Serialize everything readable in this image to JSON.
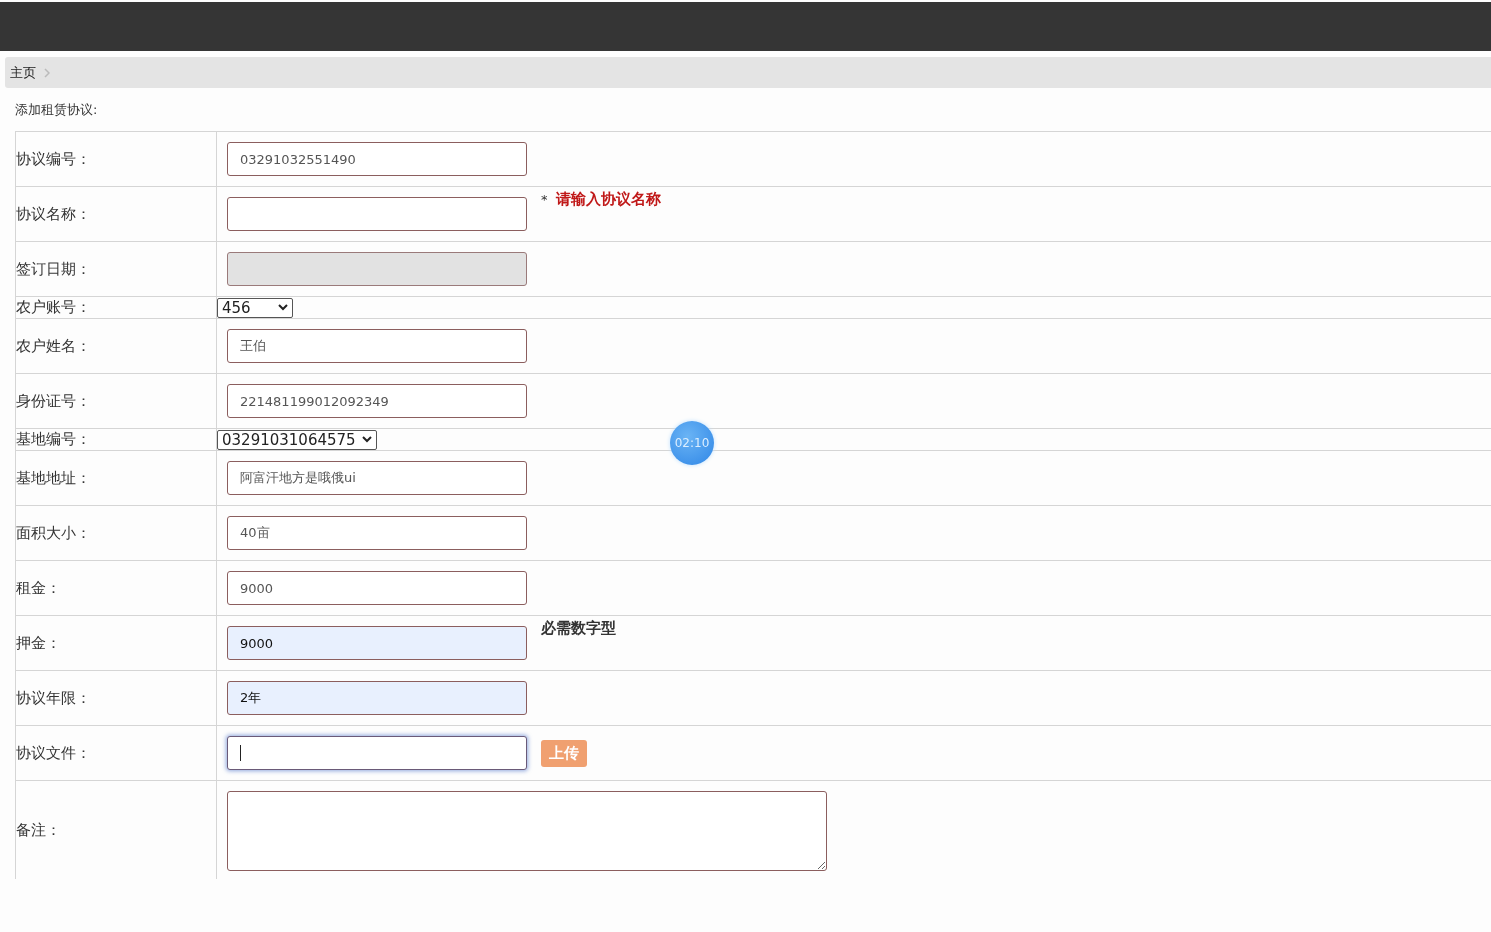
{
  "breadcrumb": {
    "items": [
      "主页"
    ]
  },
  "form_title": "添加租赁协议:",
  "fields": [
    {
      "label": "协议编号：",
      "kind": "text",
      "value": "03291032551490",
      "disabled": false,
      "autofilled": false,
      "focused": false
    },
    {
      "label": "协议名称：",
      "kind": "text",
      "disabled": false,
      "autofilled": false,
      "focused": false,
      "marker": "*",
      "hint": "请输入协议名称",
      "hint_error": true
    },
    {
      "label": "签订日期：",
      "kind": "text",
      "disabled": true,
      "autofilled": false,
      "focused": false
    },
    {
      "label": "农户账号：",
      "kind": "select",
      "value": "456"
    },
    {
      "label": "农户姓名：",
      "kind": "text",
      "value": "王伯",
      "disabled": false,
      "autofilled": false,
      "focused": false
    },
    {
      "label": "身份证号：",
      "kind": "text",
      "value": "221481199012092349",
      "disabled": false,
      "autofilled": false,
      "focused": false
    },
    {
      "label": "基地编号：",
      "kind": "select",
      "value": "03291031064575"
    },
    {
      "label": "基地地址：",
      "kind": "text",
      "value": "阿富汗地方是哦俄ui",
      "disabled": false,
      "autofilled": false,
      "focused": false
    },
    {
      "label": "面积大小：",
      "kind": "text",
      "value": "40亩",
      "disabled": false,
      "autofilled": false,
      "focused": false
    },
    {
      "label": "租金：",
      "kind": "text",
      "value": "9000",
      "disabled": false,
      "autofilled": false,
      "focused": false
    },
    {
      "label": "押金：",
      "kind": "text",
      "value": "9000",
      "disabled": false,
      "autofilled": true,
      "focused": false,
      "hint": "必需数字型",
      "hint_error": false
    },
    {
      "label": "协议年限：",
      "kind": "text",
      "value": "2年",
      "disabled": false,
      "autofilled": true,
      "focused": false
    },
    {
      "label": "协议文件：",
      "kind": "text",
      "disabled": false,
      "autofilled": false,
      "focused": true,
      "button": "上传"
    },
    {
      "label": "备注：",
      "kind": "textarea"
    }
  ],
  "timer": "02:10"
}
